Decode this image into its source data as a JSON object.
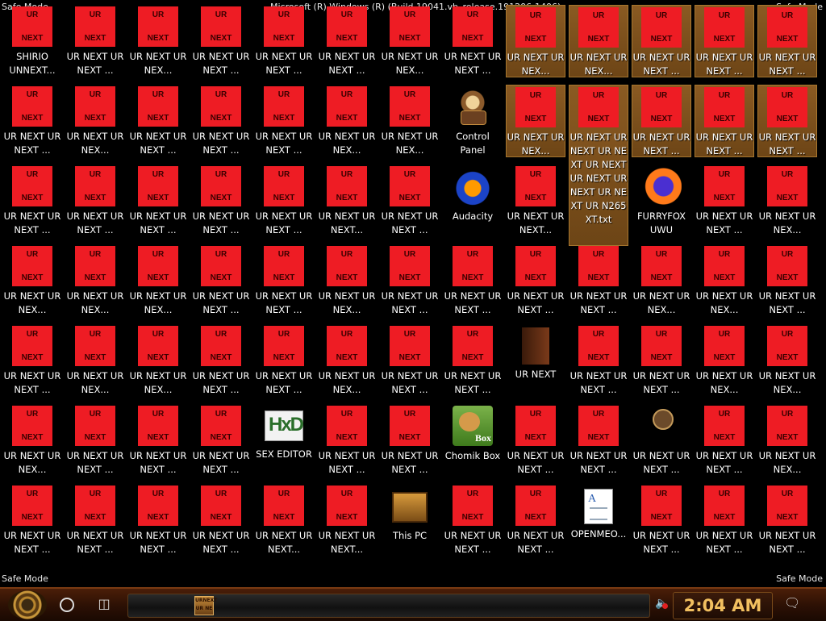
{
  "watermarks": {
    "top_left": "Safe Mode",
    "top_right": "Safe Mode",
    "top_center": "Microsoft (R) Windows (R) (Build 19041.vb_release.191206-1406)",
    "bottom_left": "Safe Mode",
    "bottom_right": "Safe Mode"
  },
  "ur_image_text": {
    "top": "UR",
    "bottom": "NEXT"
  },
  "grid": {
    "columns": 13,
    "icons": [
      {
        "kind": "ur",
        "label": "SHIRIO UNNEXT..."
      },
      {
        "kind": "ur",
        "label": "UR NEXT UR NEXT ..."
      },
      {
        "kind": "ur",
        "label": "UR NEXT UR NEX..."
      },
      {
        "kind": "ur",
        "label": "UR NEXT UR NEXT ..."
      },
      {
        "kind": "ur",
        "label": "UR NEXT UR NEXT ..."
      },
      {
        "kind": "ur",
        "label": "UR NEXT UR NEXT ..."
      },
      {
        "kind": "ur",
        "label": "UR NEXT UR NEX..."
      },
      {
        "kind": "ur",
        "label": "UR NEXT UR NEXT ..."
      },
      {
        "kind": "ur",
        "label": "UR NEXT UR NEX...",
        "selected": true
      },
      {
        "kind": "ur",
        "label": "UR NEXT UR NEX...",
        "selected": true
      },
      {
        "kind": "ur",
        "label": "UR NEXT UR NEXT ...",
        "selected": true
      },
      {
        "kind": "ur",
        "label": "UR NEXT UR NEXT ...",
        "selected": true
      },
      {
        "kind": "ur",
        "label": "UR NEXT UR NEXT ...",
        "selected": true
      },
      {
        "kind": "ur",
        "label": "UR NEXT UR NEXT ..."
      },
      {
        "kind": "ur",
        "label": "UR NEXT UR NEX..."
      },
      {
        "kind": "ur",
        "label": "UR NEXT UR NEXT ..."
      },
      {
        "kind": "ur",
        "label": "UR NEXT UR NEXT ..."
      },
      {
        "kind": "ur",
        "label": "UR NEXT UR NEXT ..."
      },
      {
        "kind": "ur",
        "label": "UR NEXT UR NEX..."
      },
      {
        "kind": "ur",
        "label": "UR NEXT UR NEX..."
      },
      {
        "kind": "control-panel",
        "label": "Control Panel"
      },
      {
        "kind": "ur",
        "label": "UR NEXT UR NEX...",
        "selected": true
      },
      {
        "kind": "ur",
        "label": "UR NEXT UR NEXT UR NEXT UR NEXT UR NEXT UR NEXT UR NEXT UR N265XT.txt",
        "selected": true,
        "expanded": true
      },
      {
        "kind": "ur",
        "label": "UR NEXT UR NEXT ...",
        "selected": true
      },
      {
        "kind": "ur",
        "label": "UR NEXT UR NEXT ...",
        "selected": true
      },
      {
        "kind": "ur",
        "label": "UR NEXT UR NEXT ...",
        "selected": true
      },
      {
        "kind": "ur",
        "label": "UR NEXT UR NEXT ..."
      },
      {
        "kind": "ur",
        "label": "UR NEXT UR NEXT ..."
      },
      {
        "kind": "ur",
        "label": "UR NEXT UR NEXT ..."
      },
      {
        "kind": "ur",
        "label": "UR NEXT UR NEXT ..."
      },
      {
        "kind": "ur",
        "label": "UR NEXT UR NEXT ..."
      },
      {
        "kind": "ur",
        "label": "UR NEXT UR NEXT..."
      },
      {
        "kind": "ur",
        "label": "UR NEXT UR NEXT ..."
      },
      {
        "kind": "audacity",
        "label": "Audacity"
      },
      {
        "kind": "ur",
        "label": "UR NEXT UR NEXT..."
      },
      {
        "kind": "hidden",
        "label": ""
      },
      {
        "kind": "firefox",
        "label": "FURRYFOX UWU"
      },
      {
        "kind": "ur",
        "label": "UR NEXT UR NEXT ..."
      },
      {
        "kind": "ur",
        "label": "UR NEXT UR NEX..."
      },
      {
        "kind": "ur",
        "label": "UR NEXT UR NEX..."
      },
      {
        "kind": "ur",
        "label": "UR NEXT UR NEX..."
      },
      {
        "kind": "ur",
        "label": "UR NEXT UR NEX..."
      },
      {
        "kind": "ur",
        "label": "UR NEXT UR NEXT ..."
      },
      {
        "kind": "ur",
        "label": "UR NEXT UR NEXT ..."
      },
      {
        "kind": "ur",
        "label": "UR NEXT UR NEX..."
      },
      {
        "kind": "ur",
        "label": "UR NEXT UR NEXT ..."
      },
      {
        "kind": "ur",
        "label": "UR NEXT UR NEXT ..."
      },
      {
        "kind": "ur",
        "label": "UR NEXT UR NEXT ..."
      },
      {
        "kind": "ur",
        "label": "UR NEXT UR NEXT ..."
      },
      {
        "kind": "ur",
        "label": "UR NEXT UR NEX..."
      },
      {
        "kind": "ur",
        "label": "UR NEXT UR NEX..."
      },
      {
        "kind": "ur",
        "label": "UR NEXT UR NEXT ..."
      },
      {
        "kind": "ur",
        "label": "UR NEXT UR NEXT ..."
      },
      {
        "kind": "ur",
        "label": "UR NEXT UR NEX..."
      },
      {
        "kind": "ur",
        "label": "UR NEXT UR NEX..."
      },
      {
        "kind": "ur",
        "label": "UR NEXT UR NEXT ..."
      },
      {
        "kind": "ur",
        "label": "UR NEXT UR NEXT ..."
      },
      {
        "kind": "ur",
        "label": "UR NEXT UR NEX..."
      },
      {
        "kind": "ur",
        "label": "UR NEXT UR NEXT ..."
      },
      {
        "kind": "ur",
        "label": "UR NEXT UR NEXT ..."
      },
      {
        "kind": "book",
        "label": "UR NEXT"
      },
      {
        "kind": "ur",
        "label": "UR NEXT UR NEXT ..."
      },
      {
        "kind": "ur",
        "label": "UR NEXT UR NEXT ..."
      },
      {
        "kind": "ur",
        "label": "UR NEXT UR NEX..."
      },
      {
        "kind": "ur",
        "label": "UR NEXT UR NEX..."
      },
      {
        "kind": "ur",
        "label": "UR NEXT UR NEX..."
      },
      {
        "kind": "ur",
        "label": "UR NEXT UR NEXT ..."
      },
      {
        "kind": "ur",
        "label": "UR NEXT UR NEXT ..."
      },
      {
        "kind": "ur",
        "label": "UR NEXT UR NEXT ..."
      },
      {
        "kind": "hxd",
        "label": "SEX EDITOR"
      },
      {
        "kind": "ur",
        "label": "UR NEXT UR NEXT ..."
      },
      {
        "kind": "ur",
        "label": "UR NEXT UR NEXT ..."
      },
      {
        "kind": "chomikbox",
        "label": "Chomik Box"
      },
      {
        "kind": "ur",
        "label": "UR NEXT UR NEXT ..."
      },
      {
        "kind": "ur",
        "label": "UR NEXT UR NEXT ..."
      },
      {
        "kind": "bug",
        "label": "UR NEXT UR NEXT ..."
      },
      {
        "kind": "ur",
        "label": "UR NEXT UR NEXT ..."
      },
      {
        "kind": "ur",
        "label": "UR NEXT UR NEX..."
      },
      {
        "kind": "ur",
        "label": "UR NEXT UR NEXT ..."
      },
      {
        "kind": "ur",
        "label": "UR NEXT UR NEXT ..."
      },
      {
        "kind": "ur",
        "label": "UR NEXT UR NEXT ..."
      },
      {
        "kind": "ur",
        "label": "UR NEXT UR NEXT ..."
      },
      {
        "kind": "ur",
        "label": "UR NEXT UR NEXT..."
      },
      {
        "kind": "ur",
        "label": "UR NEXT UR NEXT..."
      },
      {
        "kind": "this-pc",
        "label": "This PC"
      },
      {
        "kind": "ur",
        "label": "UR NEXT UR NEXT ..."
      },
      {
        "kind": "ur",
        "label": "UR NEXT UR NEXT ..."
      },
      {
        "kind": "document",
        "label": "OPENMEO..."
      },
      {
        "kind": "ur",
        "label": "UR NEXT UR NEXT ..."
      },
      {
        "kind": "ur",
        "label": "UR NEXT UR NEXT ..."
      },
      {
        "kind": "ur",
        "label": "UR NEXT UR NEXT ..."
      }
    ]
  },
  "taskbar": {
    "clock": "2:04 AM",
    "start_icon": "steampunk-gear-icon",
    "search_icon": "circle-icon",
    "task_view_icon": "task-view-icon",
    "volume_icon": "volume-muted-icon",
    "notification_icon": "speech-bubble-icon",
    "pinned_app_text": "URNEXT UR NE",
    "accent": "#f2c060"
  }
}
